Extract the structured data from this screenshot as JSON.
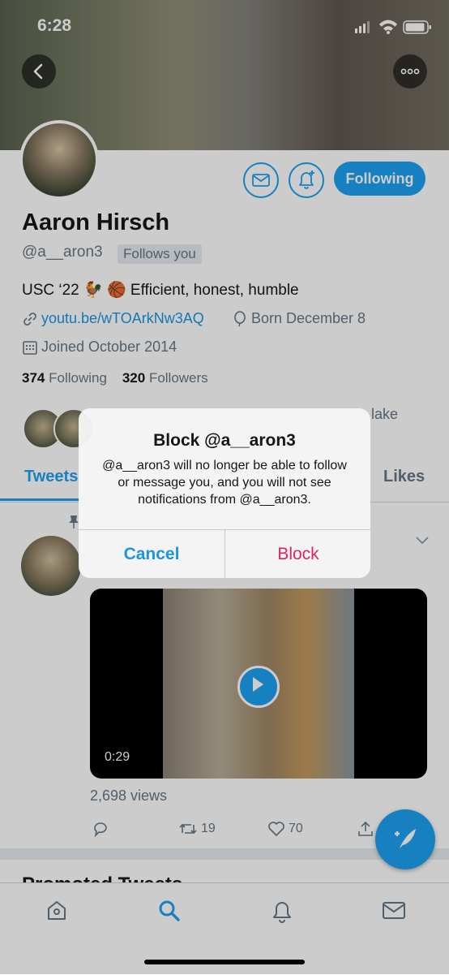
{
  "status_bar": {
    "time": "6:28"
  },
  "profile": {
    "name": "Aaron Hirsch",
    "handle": "@a__aron3",
    "follows_you": "Follows you",
    "bio": "USC ‘22 🐓 🏀 Efficient, honest, humble",
    "link": "youtu.be/wTOArkNw3AQ",
    "born": "Born December 8",
    "joined": "Joined October 2014",
    "following_count": "374",
    "following_label": "Following",
    "followers_count": "320",
    "followers_label": "Followers",
    "followed_by_fragment": "lake",
    "follow_state": "Following"
  },
  "tabs": [
    {
      "label": "Tweets"
    },
    {
      "label": "Likes"
    }
  ],
  "tweet": {
    "video_duration": "0:29",
    "views": "2,698 views",
    "retweets": "19",
    "likes": "70"
  },
  "promoted_fragment": "Promoted Tweets",
  "alert": {
    "title": "Block @a__aron3",
    "message": "@a__aron3 will no longer be able to follow or message you, and you will not see notifications from @a__aron3.",
    "cancel": "Cancel",
    "block": "Block"
  },
  "colors": {
    "accent": "#1da1f2",
    "destructive": "#e0245e",
    "alert_blue": "#1b95e0"
  },
  "icons": [
    "back-icon",
    "more-icon",
    "message-icon",
    "bell-plus-icon",
    "link-icon",
    "balloon-icon",
    "calendar-icon",
    "pin-icon",
    "chevron-down-icon",
    "play-icon",
    "reply-icon",
    "retweet-icon",
    "like-icon",
    "share-icon",
    "compose-icon",
    "home-icon",
    "search-icon",
    "notifications-icon",
    "mail-icon"
  ]
}
